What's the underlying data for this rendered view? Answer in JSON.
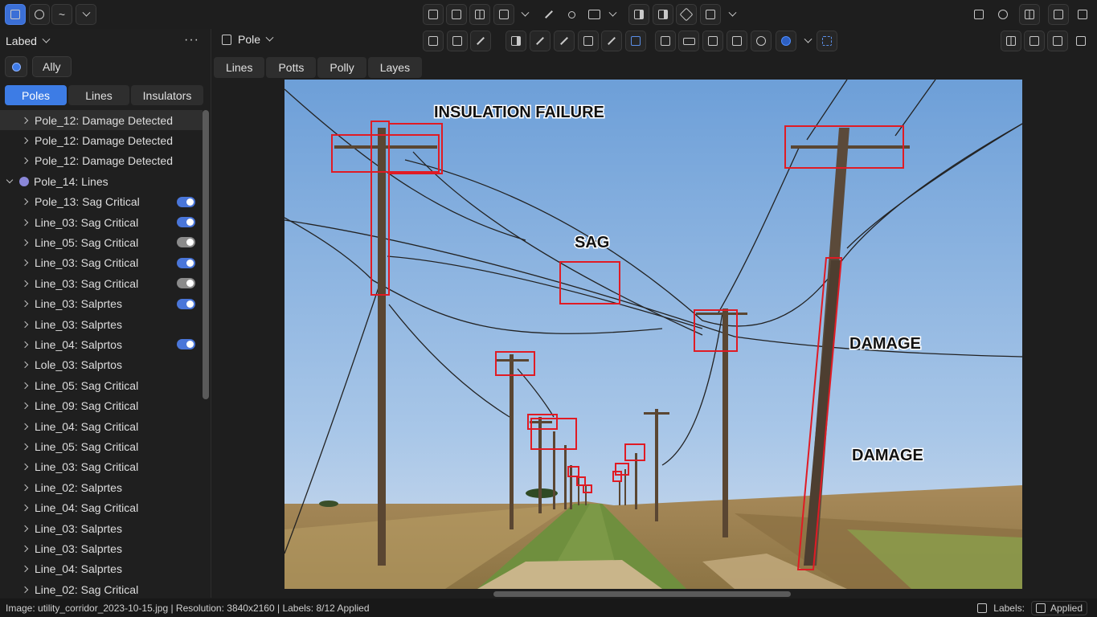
{
  "left_panel": {
    "title": "Labed",
    "more": "···",
    "ally": "Ally",
    "tabs": [
      "Poles",
      "Lines",
      "Insulators"
    ],
    "tree": [
      {
        "label": "Pole_12: Damage Detected",
        "selected": true
      },
      {
        "label": "Pole_12: Damage Detected"
      },
      {
        "label": "Pole_12: Damage Detected"
      },
      {
        "label": "Pole_14: Lines",
        "group": true
      },
      {
        "label": "Pole_13: Sag Critical",
        "toggle": "on"
      },
      {
        "label": "Line_03: Sag Critical",
        "toggle": "on"
      },
      {
        "label": "Line_05: Sag Critical",
        "toggle": "off"
      },
      {
        "label": "Line_03: Sag Critical",
        "toggle": "on"
      },
      {
        "label": "Line_03: Sag Critical",
        "toggle": "off"
      },
      {
        "label": "Line_03: Salprtes",
        "toggle": "on"
      },
      {
        "label": "Line_03: Salprtes"
      },
      {
        "label": "Line_04: Salprtos",
        "toggle": "on"
      },
      {
        "label": "Lole_03: Salprtos"
      },
      {
        "label": "Line_05: Sag Critical"
      },
      {
        "label": "Line_09: Sag Critical"
      },
      {
        "label": "Line_04: Sag Critical"
      },
      {
        "label": "Line_05: Sag Critical"
      },
      {
        "label": "Line_03: Sag Critical"
      },
      {
        "label": "Line_02: Salprtes"
      },
      {
        "label": "Line_04: Sag Critical"
      },
      {
        "label": "Line_03: Salprtes"
      },
      {
        "label": "Line_03: Salprtes"
      },
      {
        "label": "Line_04: Salprtes"
      },
      {
        "label": "Line_02: Sag Critical"
      }
    ]
  },
  "toolbar": {
    "pole_dropdown": "Pole",
    "view_tabs": [
      "Lines",
      "Potts",
      "Polly",
      "Layes"
    ]
  },
  "canvas": {
    "annotations": [
      "INSULATION FAILURE",
      "SAG",
      "DAMAGE",
      "DAMAGE"
    ]
  },
  "status": {
    "info": "Image: utility_corridor_2023-10-15.jpg | Resolution: 3840x2160 | Labels: 8/12 Applied",
    "labels": "Labels:",
    "applied": "Applied"
  },
  "colors": {
    "accent": "#3d7ce5",
    "bbox": "#e01b24",
    "sky": "#8fb8e6"
  }
}
